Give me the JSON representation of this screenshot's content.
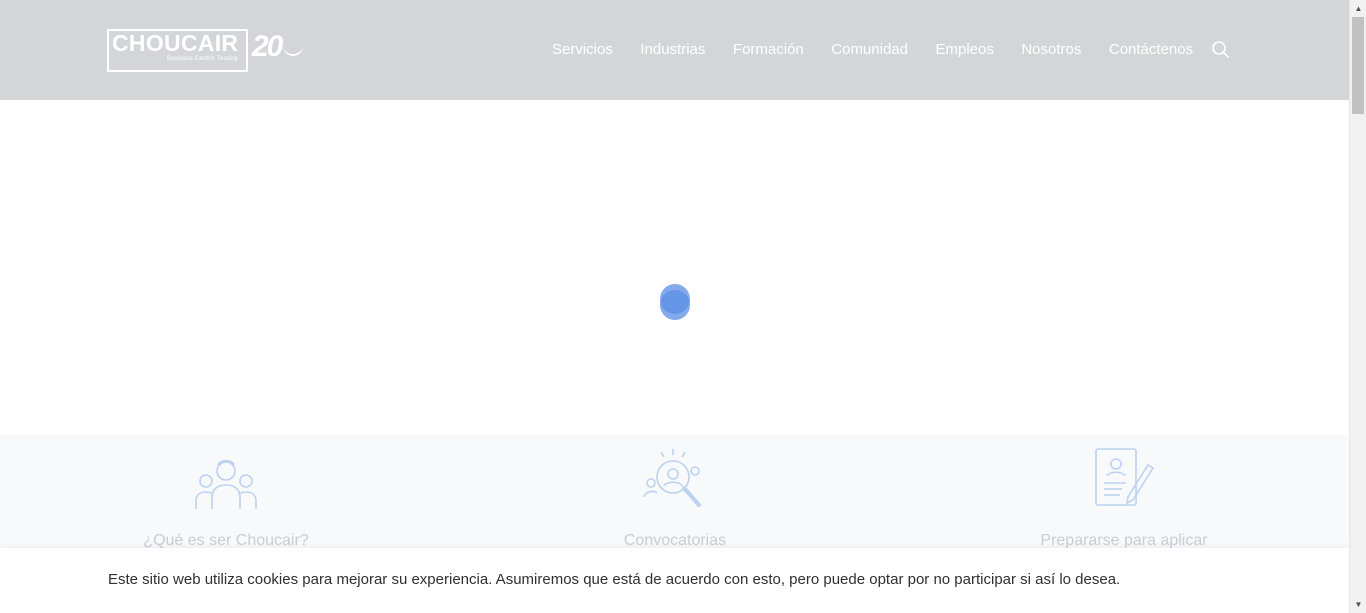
{
  "brand": {
    "name": "CHOUCAIR",
    "tagline": "Business Centric Testing",
    "anniversary": "20"
  },
  "nav": {
    "items": [
      "Servicios",
      "Industrias",
      "Formación",
      "Comunidad",
      "Empleos",
      "Nosotros",
      "Contáctenos"
    ],
    "search_icon": "search-icon"
  },
  "features": [
    {
      "icon": "team-icon",
      "label": "¿Qué es ser Choucair?"
    },
    {
      "icon": "search-people-icon",
      "label": "Convocatorias"
    },
    {
      "icon": "resume-icon",
      "label": "Prepararse para aplicar"
    }
  ],
  "cookie": {
    "text": "Este sitio web utiliza cookies para mejorar su experiencia. Asumiremos que está de acuerdo con esto, pero puede optar por no participar si así lo desea."
  },
  "colors": {
    "header_bg": "#d4d5d9",
    "loader": "#5b8ee6",
    "feature_icon": "#bcd2f0",
    "feature_label": "#c9ccd3"
  }
}
